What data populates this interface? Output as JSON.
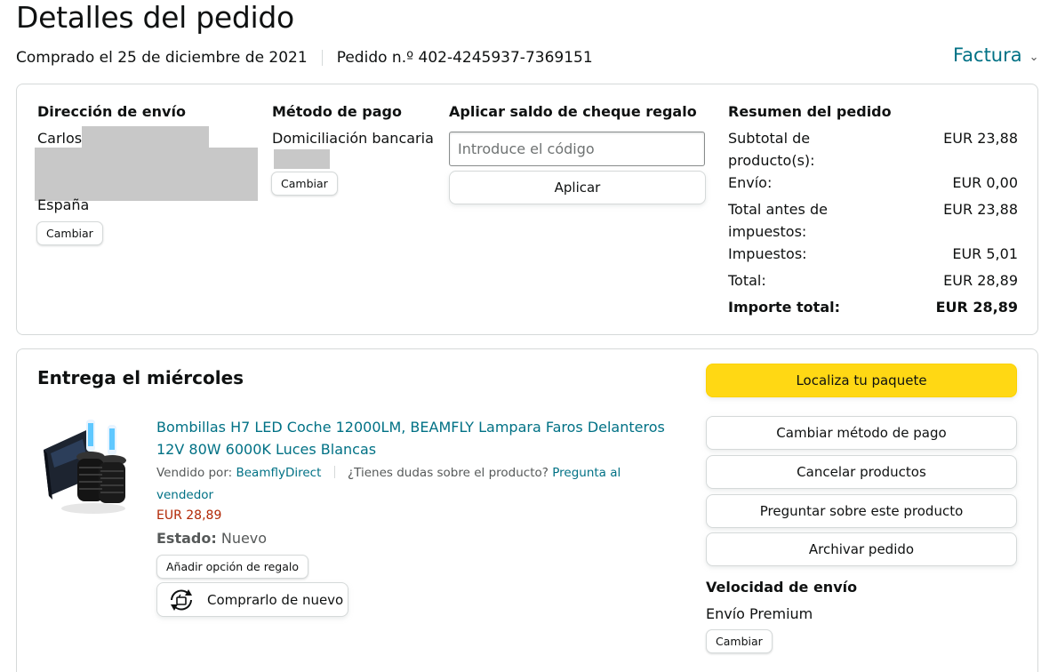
{
  "header": {
    "title": "Detalles del pedido",
    "purchased": "Comprado el 25 de diciembre de 2021",
    "order_number": "Pedido n.º 402-4245937-7369151",
    "invoice": "Factura"
  },
  "shipping": {
    "title": "Dirección de envío",
    "name": "Carlos",
    "country": "España",
    "change": "Cambiar"
  },
  "payment": {
    "title": "Método de pago",
    "method": "Domiciliación bancaria",
    "change": "Cambiar"
  },
  "gift": {
    "title": "Aplicar saldo de cheque regalo",
    "placeholder": "Introduce el código",
    "apply": "Aplicar"
  },
  "summary": {
    "title": "Resumen del pedido",
    "rows": [
      {
        "label": "Subtotal de producto(s):",
        "value": "EUR 23,88"
      },
      {
        "label": "Envío:",
        "value": "EUR 0,00"
      },
      {
        "label": "Total antes de impuestos:",
        "value": "EUR 23,88"
      },
      {
        "label": "Impuestos:",
        "value": "EUR 5,01"
      },
      {
        "label": "Total:",
        "value": "EUR 28,89"
      },
      {
        "label": "Importe total:",
        "value": "EUR 28,89"
      }
    ]
  },
  "delivery": {
    "title": "Entrega el miércoles",
    "product": {
      "title": "Bombillas H7 LED Coche 12000LM, BEAMFLY Lampara Faros Delanteros 12V 80W 6000K Luces Blancas",
      "sold_by_label": "Vendido por:",
      "seller": "BeamflyDirect",
      "question": "¿Tienes dudas sobre el producto?",
      "ask_seller": "Pregunta al vendedor",
      "price": "EUR 28,89",
      "state_label": "Estado:",
      "state_value": "Nuevo",
      "gift_option": "Añadir opción de regalo",
      "buy_again": "Comprarlo de nuevo"
    },
    "actions": {
      "track": "Localiza tu paquete",
      "change_payment": "Cambiar método de pago",
      "cancel": "Cancelar productos",
      "ask_product": "Preguntar sobre este producto",
      "archive": "Archivar pedido"
    },
    "shipping_speed": {
      "title": "Velocidad de envío",
      "value": "Envío Premium",
      "change": "Cambiar"
    }
  },
  "colors": {
    "link": "#007185",
    "price": "#b12704",
    "primary_button": "#ffd814",
    "border": "#d5d9d9"
  }
}
